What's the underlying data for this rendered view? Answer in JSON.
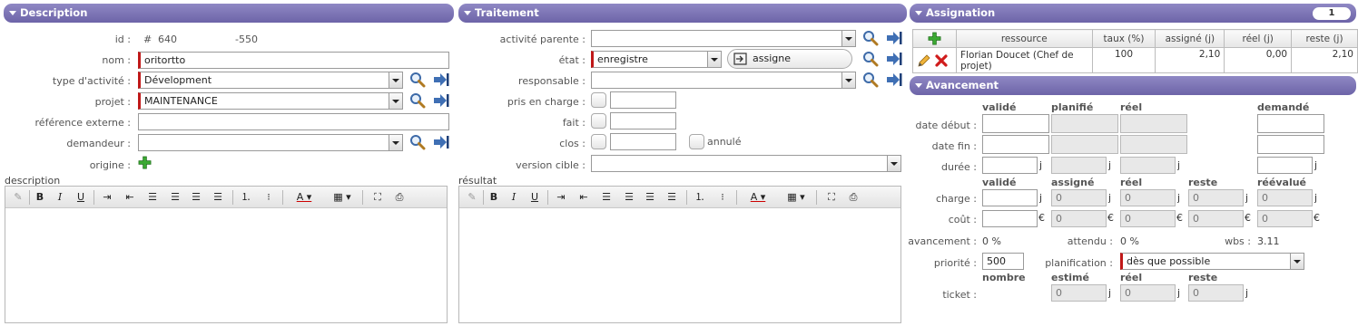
{
  "description": {
    "header": "Description",
    "id_label": "id :",
    "id_hash": "#",
    "id_value": "640",
    "id_ref": "-550",
    "nom_label": "nom :",
    "nom_value": "oritortto",
    "type_label": "type d'activité :",
    "type_value": "Dévelopment",
    "projet_label": "projet :",
    "projet_value": "MAINTENANCE",
    "ref_label": "référence externe :",
    "ref_value": "",
    "demandeur_label": "demandeur :",
    "demandeur_value": "",
    "origine_label": "origine :",
    "desc_label": "description"
  },
  "traitement": {
    "header": "Traitement",
    "parente_label": "activité parente :",
    "parente_value": "",
    "etat_label": "état :",
    "etat_value": "enregistre",
    "assigne_btn": "assigne",
    "resp_label": "responsable :",
    "resp_value": "",
    "pris_label": "pris en charge :",
    "fait_label": "fait :",
    "clos_label": "clos :",
    "annule_label": "annulé",
    "version_label": "version cible :",
    "version_value": "",
    "result_label": "résultat"
  },
  "assignation": {
    "header": "Assignation",
    "count": "1",
    "columns": [
      "ressource",
      "taux (%)",
      "assigné (j)",
      "réel (j)",
      "reste (j)"
    ],
    "row": {
      "ressource": "Florian Doucet (Chef de projet)",
      "taux": "100",
      "assigne": "2,10",
      "reel": "0,00",
      "reste": "2,10"
    }
  },
  "avancement": {
    "header": "Avancement",
    "cols1": [
      "validé",
      "planifié",
      "réel",
      "demandé"
    ],
    "date_debut_label": "date début :",
    "date_fin_label": "date fin :",
    "duree_label": "durée :",
    "cols2": [
      "validé",
      "assigné",
      "réel",
      "reste",
      "réévalué"
    ],
    "charge_label": "charge :",
    "cout_label": "coût :",
    "zero": "0",
    "j": "j",
    "euro": "€",
    "avancement_label": "avancement :",
    "avancement_value": "0 %",
    "attendu_label": "attendu :",
    "attendu_value": "0 %",
    "wbs_label": "wbs :",
    "wbs_value": "3.11",
    "priorite_label": "priorité :",
    "priorite_value": "500",
    "planif_label": "planification :",
    "planif_value": "dès que possible",
    "cols3": [
      "nombre",
      "estimé",
      "réel",
      "reste"
    ],
    "ticket_label": "ticket :"
  }
}
